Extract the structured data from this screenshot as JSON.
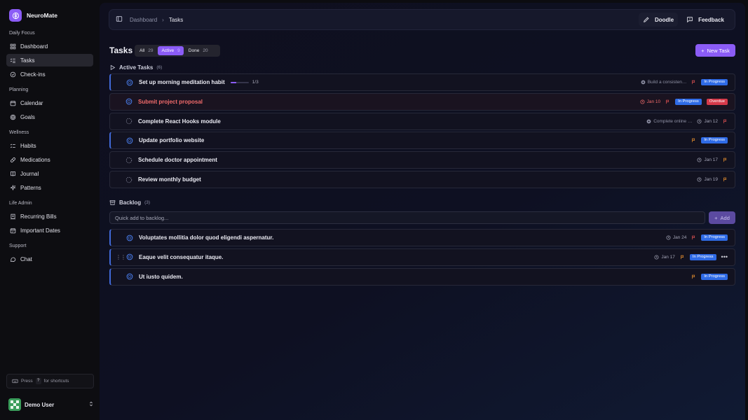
{
  "app": {
    "name": "NeuroMate"
  },
  "sidebar": {
    "sections": [
      {
        "title": "Daily Focus",
        "items": [
          {
            "label": "Dashboard",
            "icon": "dashboard-icon"
          },
          {
            "label": "Tasks",
            "icon": "tasks-icon",
            "active": true
          },
          {
            "label": "Check-ins",
            "icon": "checkins-icon"
          }
        ]
      },
      {
        "title": "Planning",
        "items": [
          {
            "label": "Calendar",
            "icon": "calendar-icon"
          },
          {
            "label": "Goals",
            "icon": "target-icon"
          }
        ]
      },
      {
        "title": "Wellness",
        "items": [
          {
            "label": "Habits",
            "icon": "habits-icon"
          },
          {
            "label": "Medications",
            "icon": "pill-icon"
          },
          {
            "label": "Journal",
            "icon": "book-icon"
          },
          {
            "label": "Patterns",
            "icon": "sparkles-icon"
          }
        ]
      },
      {
        "title": "Life Admin",
        "items": [
          {
            "label": "Recurring Bills",
            "icon": "receipt-icon"
          },
          {
            "label": "Important Dates",
            "icon": "calendar-days-icon"
          }
        ]
      },
      {
        "title": "Support",
        "items": [
          {
            "label": "Chat",
            "icon": "chat-icon"
          }
        ]
      }
    ],
    "shortcut": {
      "press": "Press",
      "key": "?",
      "suffix": "for shortcuts"
    },
    "user": {
      "name": "Demo User"
    }
  },
  "topbar": {
    "breadcrumb_root": "Dashboard",
    "breadcrumb_current": "Tasks",
    "doodle_label": "Doodle",
    "feedback_label": "Feedback"
  },
  "page": {
    "title": "Tasks",
    "filters": [
      {
        "label": "All",
        "count": "29"
      },
      {
        "label": "Active",
        "count": "9",
        "active": true
      },
      {
        "label": "Done",
        "count": "20"
      }
    ],
    "new_task_label": "New Task"
  },
  "active_group": {
    "title": "Active Tasks",
    "count": "(6)",
    "tasks": [
      {
        "title": "Set up morning meditation habit",
        "progress_text": "1/3",
        "progress": 0.33,
        "goal": "Build a consisten…",
        "date": "",
        "flag_color": "#e05252",
        "status": "In Progress",
        "accent": true
      },
      {
        "title": "Submit project proposal",
        "date": "Jan 10",
        "date_red": true,
        "flag_color": "#e05252",
        "status": "In Progress",
        "overdue_label": "Overdue",
        "overdue": true
      },
      {
        "title": "Complete React Hooks module",
        "goal": "Complete online …",
        "date": "Jan 12",
        "flag_color": "#e05252",
        "status": ""
      },
      {
        "title": "Update portfolio website",
        "date": "",
        "flag_color": "#e8902e",
        "status": "In Progress",
        "accent": true
      },
      {
        "title": "Schedule doctor appointment",
        "date": "Jan 17",
        "flag_color": "#e8902e",
        "status": ""
      },
      {
        "title": "Review monthly budget",
        "date": "Jan 19",
        "flag_color": "#e8902e",
        "status": ""
      }
    ]
  },
  "backlog_group": {
    "title": "Backlog",
    "count": "(3)",
    "quick_add_placeholder": "Quick add to backlog...",
    "add_label": "Add",
    "tasks": [
      {
        "title": "Voluptates mollitia dolor quod eligendi aspernatur.",
        "date": "Jan 24",
        "flag_color": "#e05252",
        "status": "In Progress",
        "accent": true
      },
      {
        "title": "Eaque velit consequatur itaque.",
        "date": "Jan 17",
        "flag_color": "#e8902e",
        "status": "In Progress",
        "accent": true,
        "hover": true
      },
      {
        "title": "Ut iusto quidem.",
        "date": "",
        "flag_color": "#e8902e",
        "status": "In Progress",
        "accent": true
      }
    ]
  },
  "colors": {
    "accent": "#8b5cf6",
    "status_blue": "#2f6be6",
    "overdue_red": "#d63a4a"
  }
}
